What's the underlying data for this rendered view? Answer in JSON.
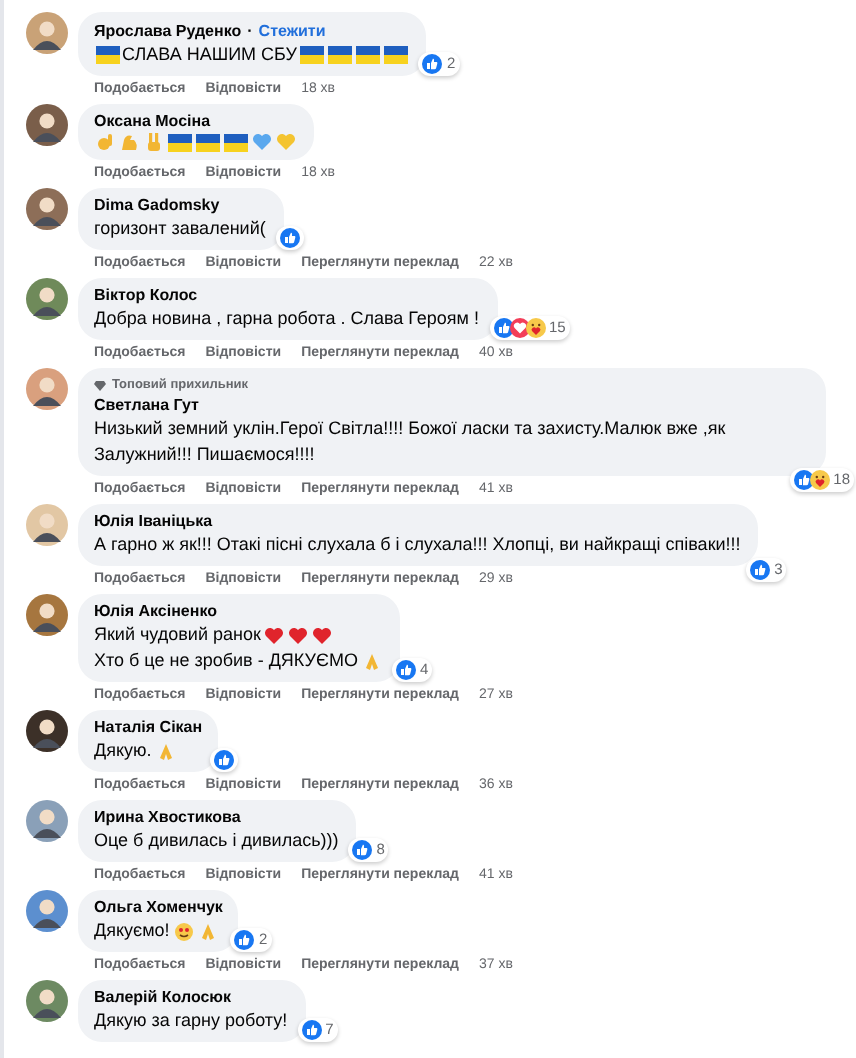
{
  "comments": [
    {
      "author": "Ярослава Руденко",
      "separator": "·",
      "follow": "Стежити",
      "lines": [
        [
          {
            "kind": "flag"
          },
          {
            "kind": "text",
            "text": "СЛАВА НАШИМ СБУ"
          },
          {
            "kind": "flag"
          },
          {
            "kind": "flag"
          },
          {
            "kind": "flag"
          },
          {
            "kind": "flag"
          }
        ]
      ],
      "reactions": [
        {
          "kind": "like"
        }
      ],
      "reaction_count": "2",
      "actions": [
        "Подобається",
        "Відповісти"
      ],
      "time": "18 хв"
    },
    {
      "author": "Оксана Мосіна",
      "lines": [
        [
          {
            "kind": "ok-hand"
          },
          {
            "kind": "muscle"
          },
          {
            "kind": "victory"
          },
          {
            "kind": "flag"
          },
          {
            "kind": "flag"
          },
          {
            "kind": "flag"
          },
          {
            "kind": "blue-heart"
          },
          {
            "kind": "yellow-heart"
          }
        ]
      ],
      "actions": [
        "Подобається",
        "Відповісти"
      ],
      "time": "18 хв"
    },
    {
      "author": "Dima Gadomsky",
      "lines": [
        [
          {
            "kind": "text",
            "text": "горизонт завалений("
          }
        ]
      ],
      "reactions": [
        {
          "kind": "like"
        }
      ],
      "actions": [
        "Подобається",
        "Відповісти",
        "Переглянути переклад"
      ],
      "time": "22 хв"
    },
    {
      "author": "Віктор Колос",
      "lines": [
        [
          {
            "kind": "text",
            "text": "Добра новина , гарна робота . Слава Героям !"
          }
        ]
      ],
      "reactions": [
        {
          "kind": "like"
        },
        {
          "kind": "love"
        },
        {
          "kind": "care"
        }
      ],
      "reaction_count": "15",
      "actions": [
        "Подобається",
        "Відповісти",
        "Переглянути переклад"
      ],
      "time": "40 хв"
    },
    {
      "author": "Светлана Гут",
      "badge": "Топовий прихильник",
      "lines": [
        [
          {
            "kind": "text",
            "text": "Низький земний уклін.Герої Світла!!!! Божої ласки та захисту.Малюк вже ,як Залужний!!! Пишаємося!!!!"
          }
        ]
      ],
      "reactions": [
        {
          "kind": "like"
        },
        {
          "kind": "care"
        }
      ],
      "reaction_count": "18",
      "actions": [
        "Подобається",
        "Відповісти",
        "Переглянути переклад"
      ],
      "time": "41 хв"
    },
    {
      "author": "Юлія Іваніцька",
      "lines": [
        [
          {
            "kind": "text",
            "text": "А гарно ж як!!! Отакі пісні слухала б і слухала!!! Хлопці, ви найкращі співаки!!!"
          }
        ]
      ],
      "reactions": [
        {
          "kind": "like"
        }
      ],
      "reaction_count": "3",
      "actions": [
        "Подобається",
        "Відповісти",
        "Переглянути переклад"
      ],
      "time": "29 хв"
    },
    {
      "author": "Юлія Аксіненко",
      "lines": [
        [
          {
            "kind": "text",
            "text": "Який чудовий ранок"
          },
          {
            "kind": "heart"
          },
          {
            "kind": "heart"
          },
          {
            "kind": "heart"
          }
        ],
        [
          {
            "kind": "text",
            "text": "Хто б це не зробив - ДЯКУЄМО"
          },
          {
            "kind": "pray"
          }
        ]
      ],
      "reactions": [
        {
          "kind": "like"
        }
      ],
      "reaction_count": "4",
      "actions": [
        "Подобається",
        "Відповісти",
        "Переглянути переклад"
      ],
      "time": "27 хв"
    },
    {
      "author": "Наталія Сікан",
      "lines": [
        [
          {
            "kind": "text",
            "text": "Дякую."
          },
          {
            "kind": "pray"
          }
        ]
      ],
      "reactions": [
        {
          "kind": "like"
        }
      ],
      "actions": [
        "Подобається",
        "Відповісти",
        "Переглянути переклад"
      ],
      "time": "36 хв"
    },
    {
      "author": "Ирина Хвостикова",
      "lines": [
        [
          {
            "kind": "text",
            "text": "Оце б дивилась і дивилась)))"
          }
        ]
      ],
      "reactions": [
        {
          "kind": "like"
        }
      ],
      "reaction_count": "8",
      "actions": [
        "Подобається",
        "Відповісти",
        "Переглянути переклад"
      ],
      "time": "41 хв"
    },
    {
      "author": "Ольга Хоменчук",
      "lines": [
        [
          {
            "kind": "text",
            "text": "Дякуємо!"
          },
          {
            "kind": "hug-face"
          },
          {
            "kind": "pray"
          }
        ]
      ],
      "reactions": [
        {
          "kind": "like"
        }
      ],
      "reaction_count": "2",
      "actions": [
        "Подобається",
        "Відповісти",
        "Переглянути переклад"
      ],
      "time": "37 хв"
    },
    {
      "author": "Валерій Колосюк",
      "lines": [
        [
          {
            "kind": "text",
            "text": "Дякую за гарну роботу!"
          }
        ]
      ],
      "reactions": [
        {
          "kind": "like"
        }
      ],
      "reaction_count": "7"
    }
  ]
}
